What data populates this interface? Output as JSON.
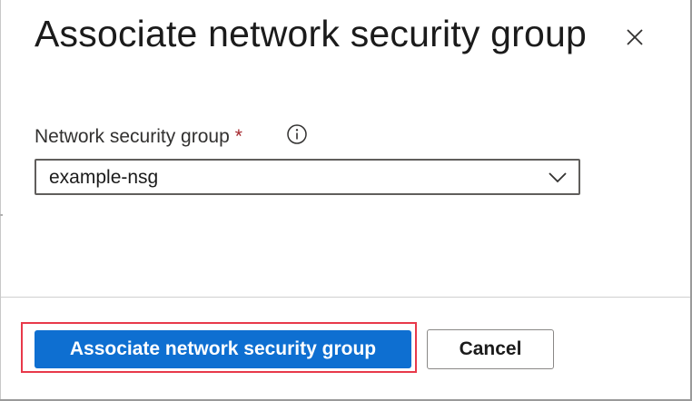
{
  "dialog": {
    "title": "Associate network security group",
    "close_icon": "close-icon"
  },
  "form": {
    "nsg_field": {
      "label": "Network security group",
      "required_marker": "*",
      "info_icon": "info-icon",
      "selected_value": "example-nsg",
      "dropdown_icon": "chevron-down-icon"
    }
  },
  "footer": {
    "primary_label": "Associate network security group",
    "cancel_label": "Cancel"
  },
  "colors": {
    "primary_button": "#0e6fd1",
    "highlight_border": "#e8394a",
    "required_marker": "#a4262c"
  }
}
